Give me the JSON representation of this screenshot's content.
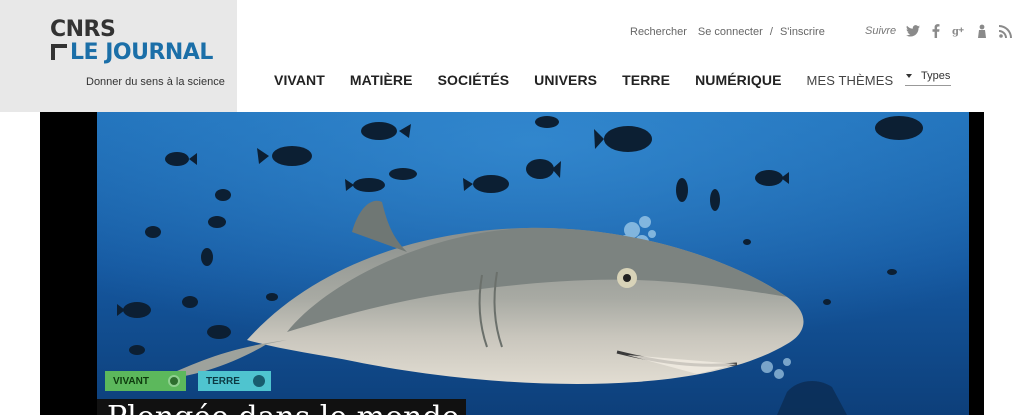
{
  "brand": {
    "org": "CNRS",
    "name": "LE JOURNAL",
    "tagline": "Donner du sens à la science",
    "accent": "#1b6fa8"
  },
  "utility": {
    "search": "Rechercher",
    "login": "Se connecter",
    "separator": "/",
    "signup": "S'inscrire"
  },
  "social": {
    "follow_label": "Suivre",
    "icons": [
      "twitter-icon",
      "facebook-icon",
      "google-plus-icon",
      "person-icon",
      "rss-icon"
    ]
  },
  "nav": {
    "items": [
      "VIVANT",
      "MATIÈRE",
      "SOCIÉTÉS",
      "UNIVERS",
      "TERRE",
      "NUMÉRIQUE"
    ],
    "themes": "MES THÈMES",
    "types": "Types"
  },
  "hero": {
    "tags": [
      {
        "label": "VIVANT",
        "color": "#5cb85c"
      },
      {
        "label": "TERRE",
        "color": "#4fc4cf"
      }
    ],
    "headline": "Plongée dans le monde"
  }
}
